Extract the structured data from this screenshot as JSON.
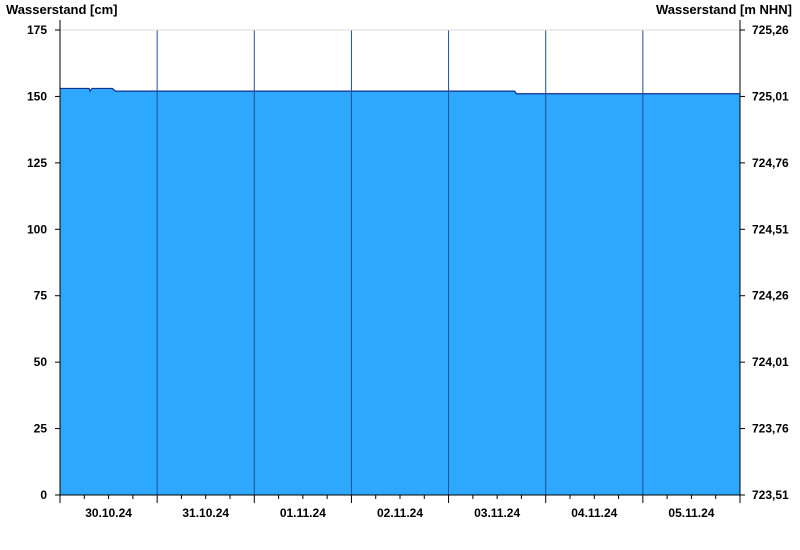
{
  "chart_data": {
    "type": "area",
    "y_left_title": "Wasserstand [cm]",
    "y_right_title": "Wasserstand [m NHN]",
    "y_left_ticks": [
      "0",
      "25",
      "50",
      "75",
      "100",
      "125",
      "150",
      "175"
    ],
    "y_right_ticks": [
      "723,51",
      "723,76",
      "724,01",
      "724,26",
      "724,51",
      "724,76",
      "725,01",
      "725,26"
    ],
    "ylim": [
      0,
      175
    ],
    "x_ticks": [
      "30.10.24",
      "31.10.24",
      "01.11.24",
      "02.11.24",
      "03.11.24",
      "04.11.24",
      "05.11.24"
    ],
    "xlim_days": [
      0,
      7
    ],
    "series": [
      {
        "points": [
          [
            0.0,
            153
          ],
          [
            0.3,
            153
          ],
          [
            0.31,
            152
          ],
          [
            0.33,
            153
          ],
          [
            0.54,
            153
          ],
          [
            0.57,
            152
          ],
          [
            1.0,
            152
          ],
          [
            2.0,
            152
          ],
          [
            3.0,
            152
          ],
          [
            4.0,
            152
          ],
          [
            4.68,
            152
          ],
          [
            4.7,
            151
          ],
          [
            5.0,
            151
          ],
          [
            6.0,
            151
          ],
          [
            7.0,
            151
          ]
        ]
      }
    ],
    "colors": {
      "fill": "#2ea8ff",
      "line": "#0f2f8c",
      "day_separator": "#1d4f99",
      "grid": "#d8d8d8",
      "axis": "#000000"
    },
    "grid": "horizontal-top-only"
  }
}
